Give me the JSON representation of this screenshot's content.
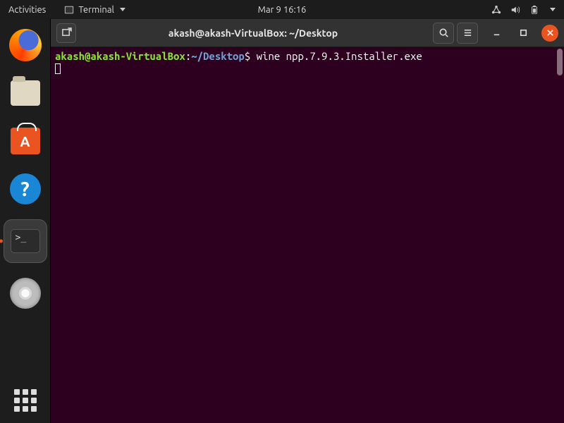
{
  "topbar": {
    "activities": "Activities",
    "app_name": "Terminal",
    "clock": "Mar 9  16:16"
  },
  "window": {
    "title": "akash@akash-VirtualBox: ~/Desktop"
  },
  "dock": {
    "items": [
      {
        "name": "firefox"
      },
      {
        "name": "files"
      },
      {
        "name": "ubuntu-software"
      },
      {
        "name": "help"
      },
      {
        "name": "terminal",
        "active": true
      },
      {
        "name": "disc"
      }
    ]
  },
  "terminal": {
    "prompt_user": "akash@akash-VirtualBox",
    "prompt_sep": ":",
    "prompt_path": "~/Desktop",
    "prompt_sym": "$",
    "command": "wine npp.7.9.3.Installer.exe"
  }
}
